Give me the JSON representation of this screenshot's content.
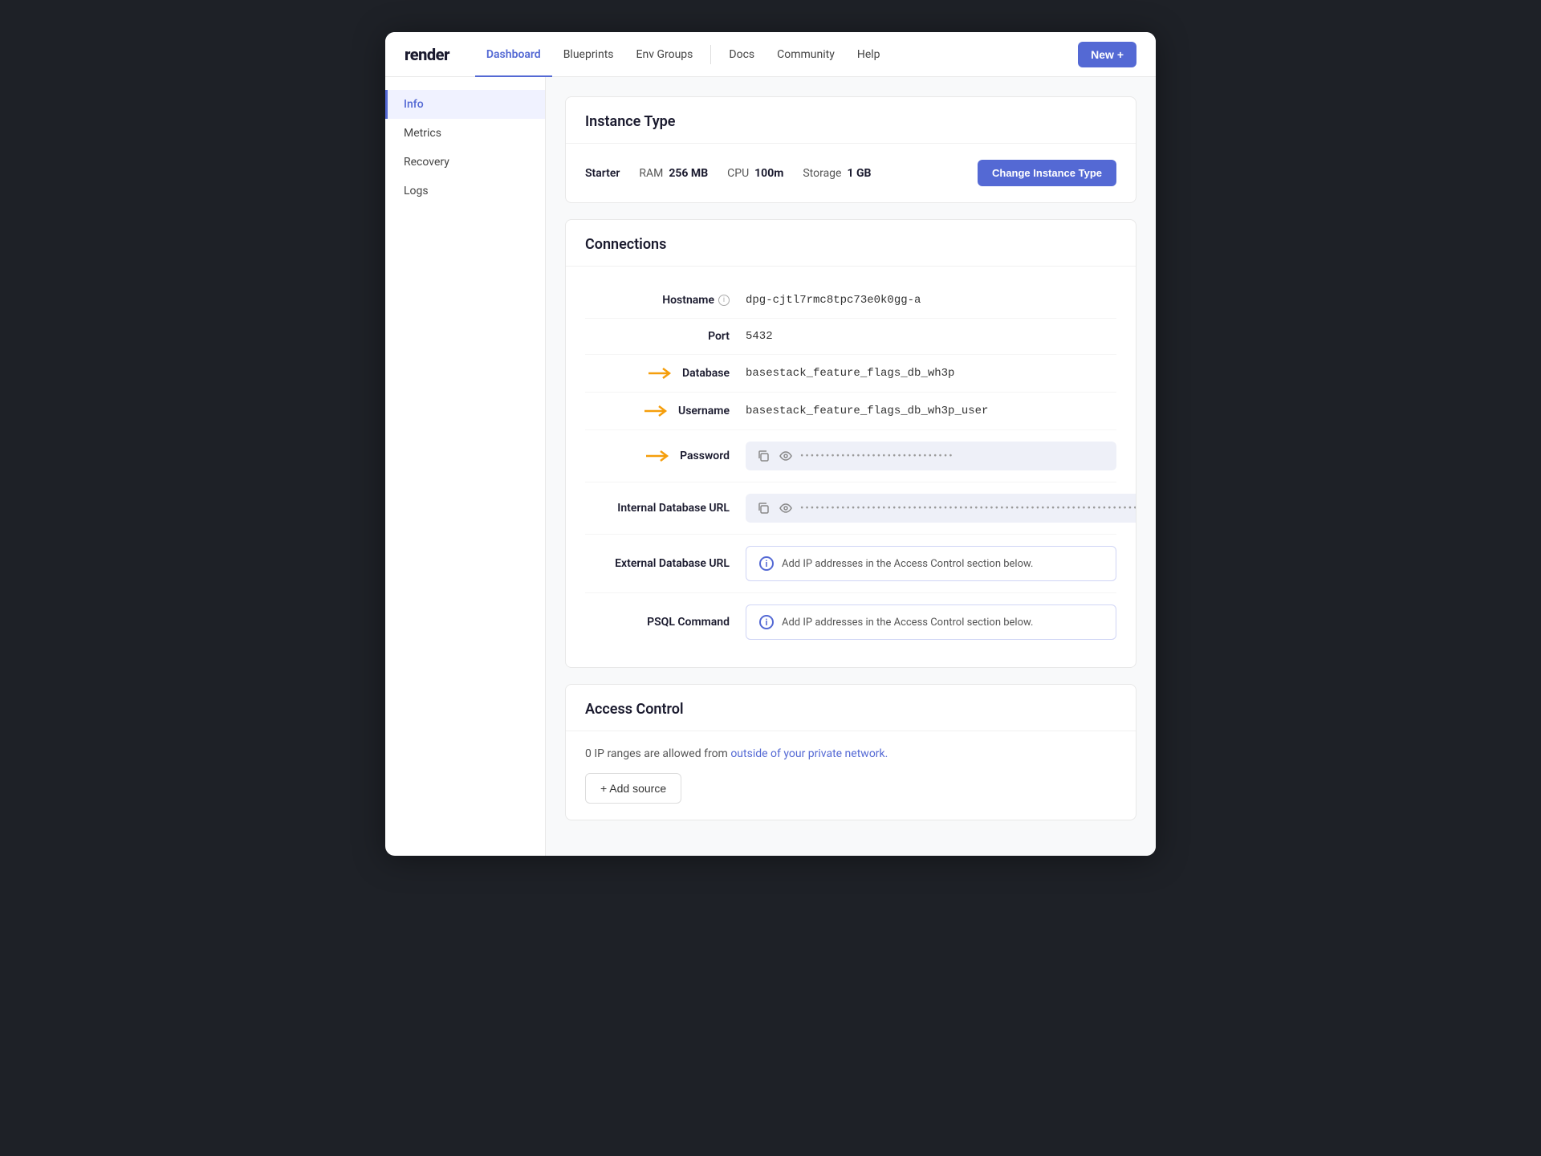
{
  "brand": "render",
  "nav": {
    "links": [
      {
        "id": "dashboard",
        "label": "Dashboard",
        "active": true
      },
      {
        "id": "blueprints",
        "label": "Blueprints",
        "active": false
      },
      {
        "id": "env-groups",
        "label": "Env Groups",
        "active": false
      },
      {
        "id": "docs",
        "label": "Docs",
        "active": false
      },
      {
        "id": "community",
        "label": "Community",
        "active": false
      },
      {
        "id": "help",
        "label": "Help",
        "active": false
      }
    ],
    "new_button": "New +"
  },
  "sidebar": {
    "items": [
      {
        "id": "info",
        "label": "Info",
        "active": true
      },
      {
        "id": "metrics",
        "label": "Metrics",
        "active": false
      },
      {
        "id": "recovery",
        "label": "Recovery",
        "active": false
      },
      {
        "id": "logs",
        "label": "Logs",
        "active": false
      }
    ]
  },
  "instance_type": {
    "section_title": "Instance Type",
    "tier": "Starter",
    "ram_label": "RAM",
    "ram_value": "256 MB",
    "cpu_label": "CPU",
    "cpu_value": "100m",
    "storage_label": "Storage",
    "storage_value": "1 GB",
    "change_button": "Change Instance Type"
  },
  "connections": {
    "section_title": "Connections",
    "fields": [
      {
        "id": "hostname",
        "label": "Hostname",
        "has_info": true,
        "value": "dpg-cjtl7rmc8tpc73e0k0gg-a",
        "type": "text",
        "has_arrow": false
      },
      {
        "id": "port",
        "label": "Port",
        "has_info": false,
        "value": "5432",
        "type": "text",
        "has_arrow": false
      },
      {
        "id": "database",
        "label": "Database",
        "has_info": false,
        "value": "basestack_feature_flags_db_wh3p",
        "type": "text",
        "has_arrow": true
      },
      {
        "id": "username",
        "label": "Username",
        "has_info": false,
        "value": "basestack_feature_flags_db_wh3p_user",
        "type": "text",
        "has_arrow": true
      },
      {
        "id": "password",
        "label": "Password",
        "has_info": false,
        "value": "••••••••••••••••••••••••••••••",
        "type": "password",
        "has_arrow": true
      },
      {
        "id": "internal-db-url",
        "label": "Internal Database URL",
        "has_info": false,
        "value": "••••••••••••••••••••••••••••••••••••••••••••••••••••••••••••••••••••",
        "type": "password",
        "has_arrow": false
      },
      {
        "id": "external-db-url",
        "label": "External Database URL",
        "has_info": false,
        "value": "Add IP addresses in the Access Control section below.",
        "type": "info",
        "has_arrow": false
      },
      {
        "id": "psql-command",
        "label": "PSQL Command",
        "has_info": false,
        "value": "Add IP addresses in the Access Control section below.",
        "type": "info",
        "has_arrow": false
      }
    ]
  },
  "access_control": {
    "section_title": "Access Control",
    "description_start": "0 IP ranges are allowed from ",
    "link_text": "outside of your private network.",
    "add_source_label": "+ Add source"
  },
  "colors": {
    "accent": "#5469d4",
    "orange": "#e07b00",
    "warning_arrow": "#f59e0b"
  }
}
